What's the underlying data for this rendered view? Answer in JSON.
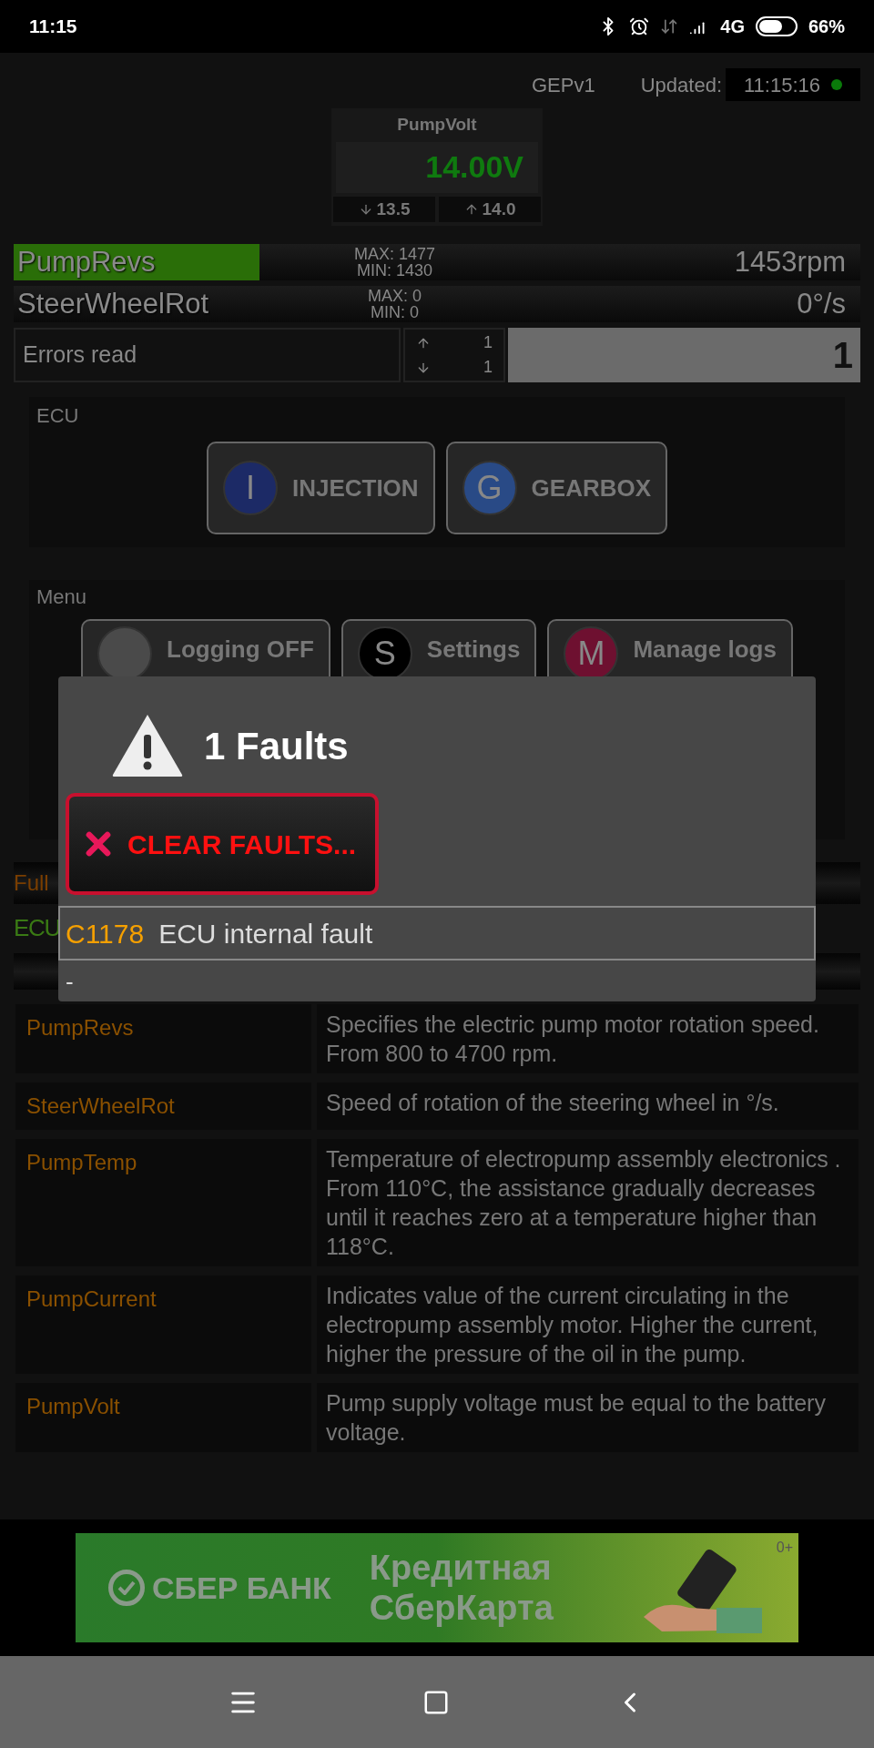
{
  "status_bar": {
    "time": "11:15",
    "network": "4G",
    "battery": "66%"
  },
  "header": {
    "device": "GEPv1",
    "updated_label": "Updated:",
    "updated_time": "11:15:16",
    "online": true
  },
  "gauge": {
    "title": "PumpVolt",
    "value": "14.00V",
    "min": "13.5",
    "max": "14.0"
  },
  "bars": [
    {
      "name": "PumpRevs",
      "max": "MAX: 1477",
      "min": "MIN: 1430",
      "value": "1453rpm",
      "level": 0.29
    },
    {
      "name": "SteerWheelRot",
      "max": "MAX: 0",
      "min": "MIN: 0",
      "value": "0°/s",
      "level": 0
    }
  ],
  "errors": {
    "label": "Errors read",
    "up": "1",
    "down": "1",
    "value": "1"
  },
  "ecu": {
    "title": "ECU",
    "buttons": [
      {
        "letter": "I",
        "label": "INJECTION",
        "color": "#1c2a66"
      },
      {
        "letter": "G",
        "label": "GEARBOX",
        "color": "#294a86"
      }
    ]
  },
  "menu": {
    "title": "Menu",
    "buttons": [
      {
        "label": "Logging OFF",
        "color": "#4a4a4a"
      },
      {
        "letter": "S",
        "label": "Settings",
        "color": "#000000"
      },
      {
        "letter": "M",
        "label": "Manage logs",
        "color": "#6e1030"
      }
    ]
  },
  "section": {
    "title": "Full",
    "subtitle": "ECU"
  },
  "table": {
    "rows": [
      {
        "param": "PumpRevs",
        "description": "Specifies the electric pump motor rotation speed. From 800 to 4700 rpm."
      },
      {
        "param": "SteerWheelRot",
        "description": "Speed of rotation of the steering wheel in °/s."
      },
      {
        "param": "PumpTemp",
        "description": "Temperature of electropump assembly electronics . From 110°C, the assistance gradually decreases until it reaches zero at a temperature higher than 118°C."
      },
      {
        "param": "PumpCurrent",
        "description": "Indicates value of the current circulating in the electropump assembly motor. Higher the current, higher the pressure of the oil in the pump."
      },
      {
        "param": "PumpVolt",
        "description": "Pump supply voltage must be equal to the battery voltage."
      }
    ]
  },
  "ad": {
    "brand": "СБЕР БАНК",
    "headline_1": "Кредитная",
    "headline_2": "СберКарта",
    "age_rating": "0+"
  },
  "dialog": {
    "title": "1 Faults",
    "clear_button": "CLEAR FAULTS...",
    "faults": [
      {
        "code": "C1178",
        "text": "ECU internal fault"
      }
    ],
    "footer": "-"
  }
}
